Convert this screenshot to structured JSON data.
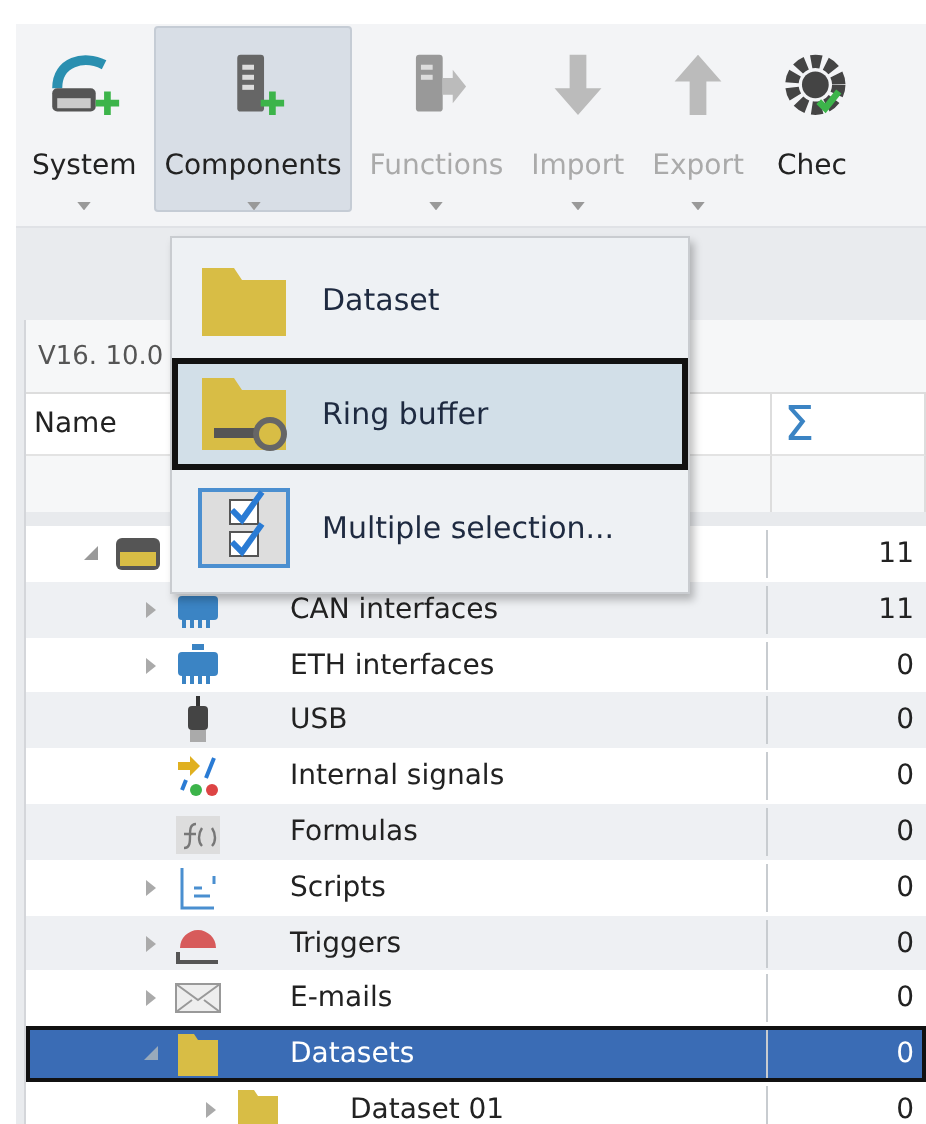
{
  "toolbar": {
    "buttons": [
      {
        "label": "System",
        "selected": false,
        "disabled": false,
        "dropdown": true
      },
      {
        "label": "Components",
        "selected": true,
        "disabled": false,
        "dropdown": true
      },
      {
        "label": "Functions",
        "selected": false,
        "disabled": true,
        "dropdown": true
      },
      {
        "label": "Import",
        "selected": false,
        "disabled": true,
        "dropdown": true
      },
      {
        "label": "Export",
        "selected": false,
        "disabled": true,
        "dropdown": true
      },
      {
        "label": "Chec",
        "selected": false,
        "disabled": false,
        "dropdown": false
      }
    ]
  },
  "dropdown_menu": {
    "items": [
      {
        "label": "Dataset",
        "selected": false
      },
      {
        "label": "Ring buffer",
        "selected": true
      },
      {
        "label": "Multiple selection...",
        "selected": false
      }
    ]
  },
  "panel": {
    "version": "V16. 10.0",
    "columns": [
      "Name",
      "Σ"
    ],
    "tree": [
      {
        "count": "11",
        "selected": false,
        "expanded": true,
        "children": [
          {
            "name": "CAN interfaces",
            "count": "11",
            "selected": false,
            "expanded": false
          },
          {
            "name": "ETH interfaces",
            "count": "0",
            "selected": false,
            "expanded": false
          },
          {
            "name": "USB",
            "count": "0",
            "selected": false
          },
          {
            "name": "Internal signals",
            "count": "0",
            "selected": false
          },
          {
            "name": "Formulas",
            "count": "0",
            "selected": false
          },
          {
            "name": "Scripts",
            "count": "0",
            "selected": false,
            "expanded": false
          },
          {
            "name": "Triggers",
            "count": "0",
            "selected": false,
            "expanded": false
          },
          {
            "name": "E-mails",
            "count": "0",
            "selected": false,
            "expanded": false
          },
          {
            "name": "Datasets",
            "count": "0",
            "selected": true,
            "expanded": true,
            "children": [
              {
                "name": "Dataset 01",
                "count": "0",
                "selected": false,
                "expanded": false
              }
            ]
          }
        ]
      }
    ]
  }
}
